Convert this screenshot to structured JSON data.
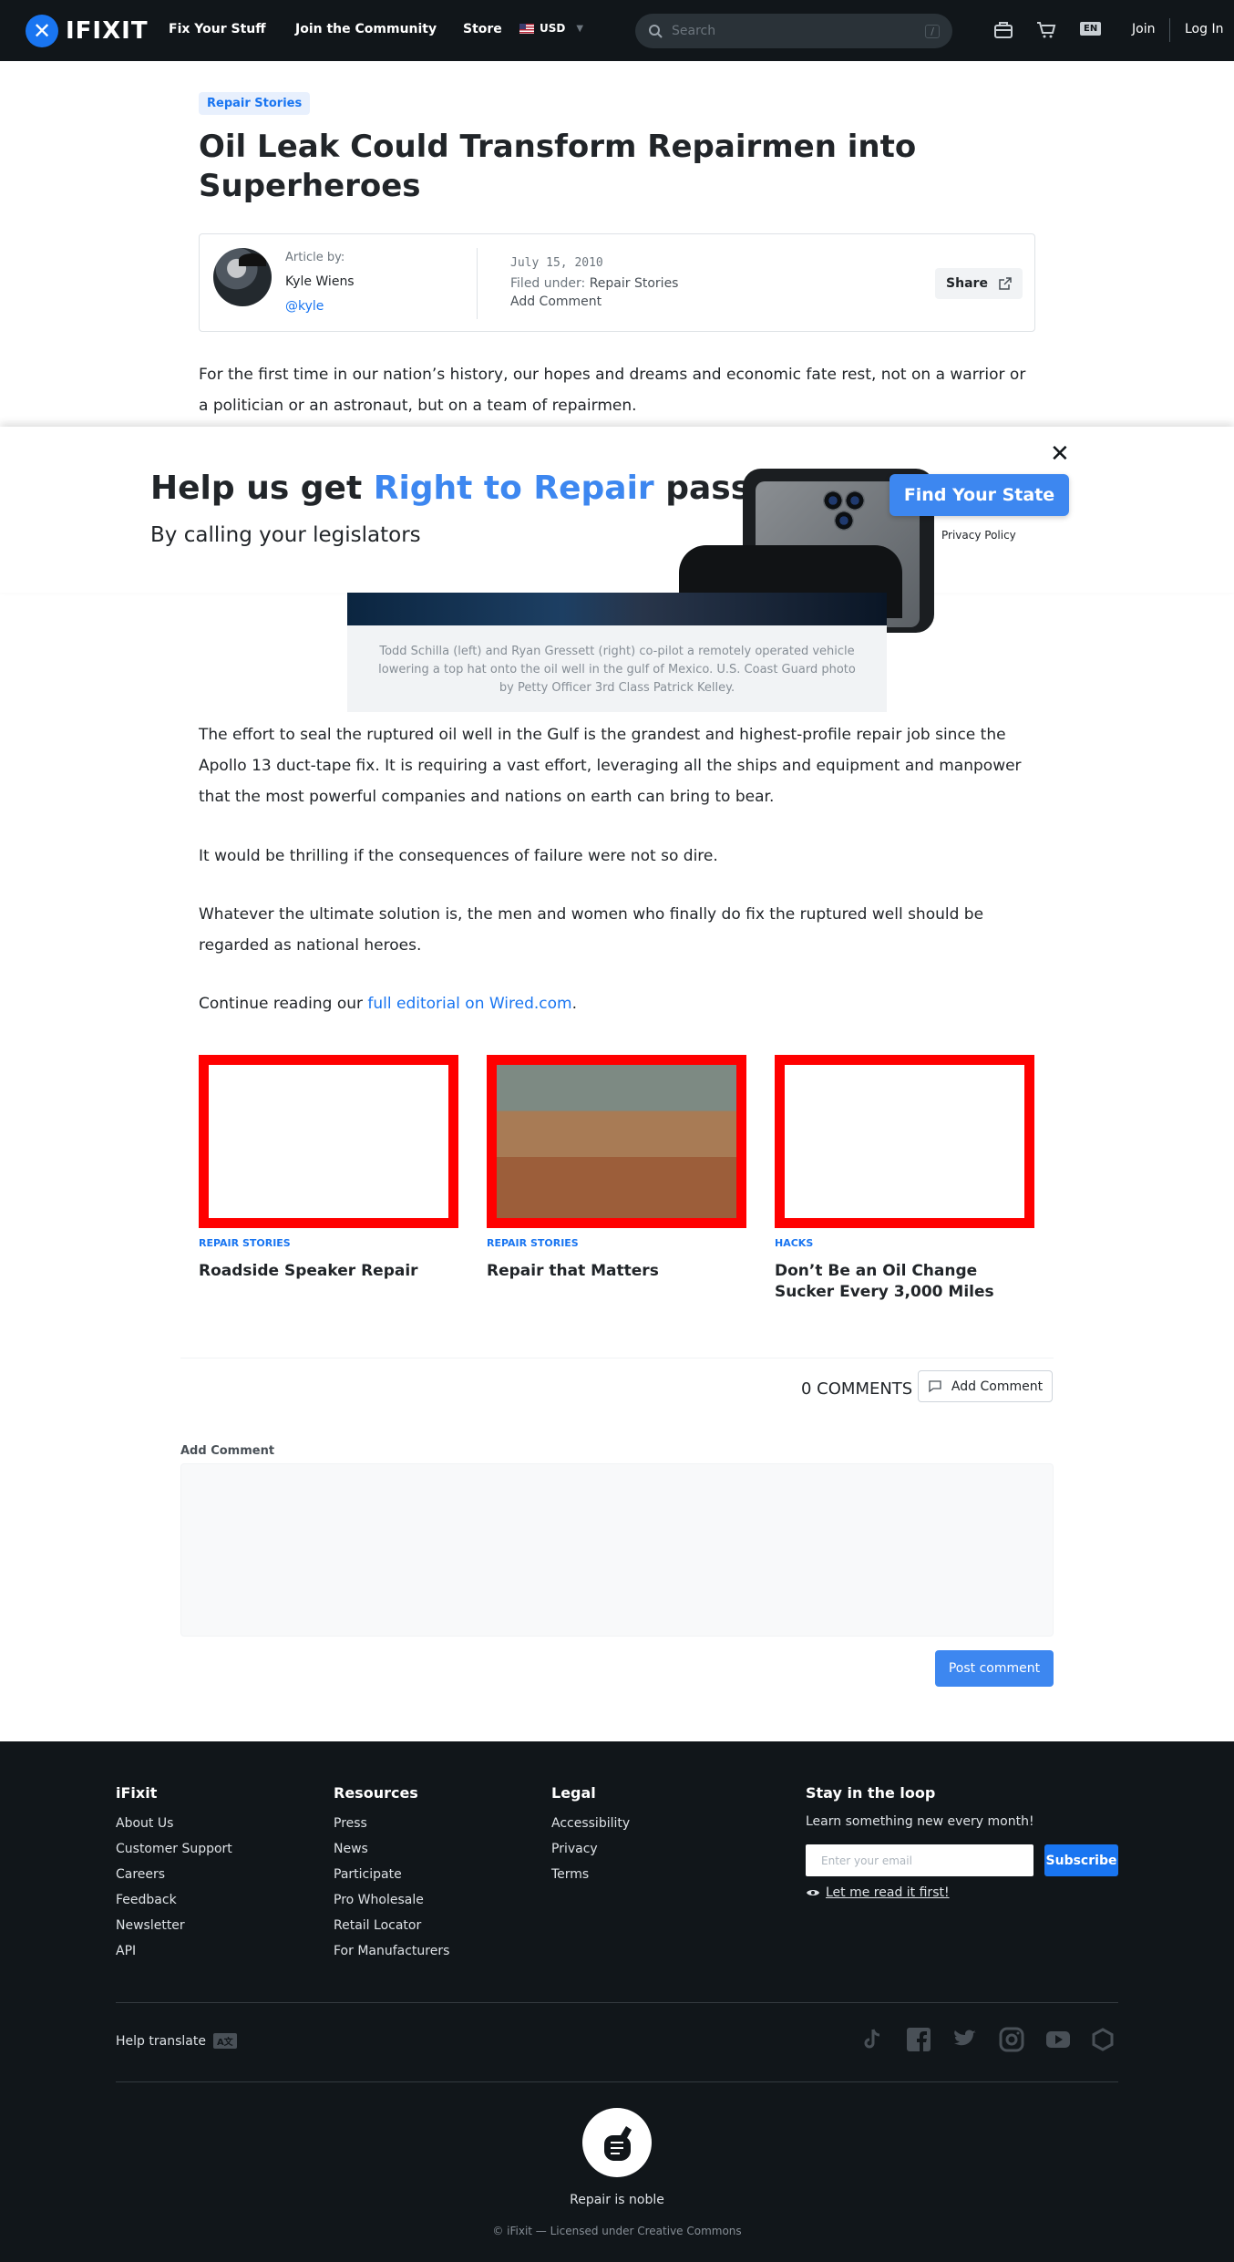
{
  "nav": {
    "logo_text": "IFIXIT",
    "links": [
      "Fix Your Stuff",
      "Join the Community",
      "Store"
    ],
    "currency": "USD",
    "search_placeholder": "Search",
    "search_shortcut": "/",
    "lang": "EN",
    "join": "Join",
    "login": "Log In"
  },
  "article": {
    "tag": "Repair Stories",
    "title": "Oil Leak Could Transform Repairmen into Superheroes",
    "byline_label": "Article by:",
    "author": "Kyle Wiens",
    "handle": "@kyle",
    "date": "July 15, 2010",
    "filed_label": "Filed under:",
    "filed_value": "Repair Stories",
    "add_comment": "Add Comment",
    "share": "Share",
    "intro": "For the first time in our nation’s history, our hopes and dreams and economic fate rest, not on a warrior or a politician or an astronaut, but on a team of repairmen.",
    "caption": "Todd Schilla (left) and Ryan Gressett (right) co-pilot a remotely operated vehicle lowering a top hat onto the oil well in the gulf of Mexico. U.S. Coast Guard photo by Petty Officer 3rd Class Patrick Kelley.",
    "p1": "The effort to seal the ruptured oil well in the Gulf is the grandest and highest-profile repair job since the Apollo 13 duct-tape fix. It is requiring a vast effort, leveraging all the ships and equipment and manpower that the most powerful companies and nations on earth can bring to bear.",
    "p2": "It would be thrilling if the consequences of failure were not so dire.",
    "p3": "Whatever the ultimate solution is, the men and women who finally do fix the ruptured well should be regarded as national heroes.",
    "p4_prefix": "Continue reading our ",
    "p4_link": "full editorial on Wired.com",
    "p4_suffix": "."
  },
  "banner": {
    "head_pre": "Help us get ",
    "head_accent": "Right to Repair",
    "head_post": " passed",
    "sub": "By calling your legislators",
    "button": "Find Your State",
    "privacy": "Privacy Policy",
    "close": "✕"
  },
  "related": [
    {
      "category": "Repair Stories",
      "title": "Roadside Speaker Repair"
    },
    {
      "category": "Repair Stories",
      "title": "Repair that Matters"
    },
    {
      "category": "Hacks",
      "title": "Don’t Be an Oil Change Sucker Every 3,000 Miles"
    }
  ],
  "comments": {
    "count": "0 COMMENTS",
    "add_button": "Add Comment",
    "label": "Add Comment",
    "post": "Post comment"
  },
  "footer": {
    "col1": {
      "title": "iFixit",
      "links": [
        "About Us",
        "Customer Support",
        "Careers",
        "Feedback",
        "Newsletter",
        "API"
      ]
    },
    "col2": {
      "title": "Resources",
      "links": [
        "Press",
        "News",
        "Participate",
        "Pro Wholesale",
        "Retail Locator",
        "For Manufacturers"
      ]
    },
    "col3": {
      "title": "Legal",
      "links": [
        "Accessibility",
        "Privacy",
        "Terms"
      ]
    },
    "loop": {
      "title": "Stay in the loop",
      "sub": "Learn something new every month!",
      "email_placeholder": "Enter your email",
      "subscribe": "Subscribe",
      "read_first": "Let me read it first!"
    },
    "translate": "Help translate",
    "slogan": "Repair is noble",
    "copyright": "© iFixit — Licensed under Creative Commons"
  },
  "colors": {
    "brand": "#1975f1",
    "banner_accent": "#3d87f0",
    "nav_bg": "#11161a",
    "card_border": "#ff0000"
  }
}
